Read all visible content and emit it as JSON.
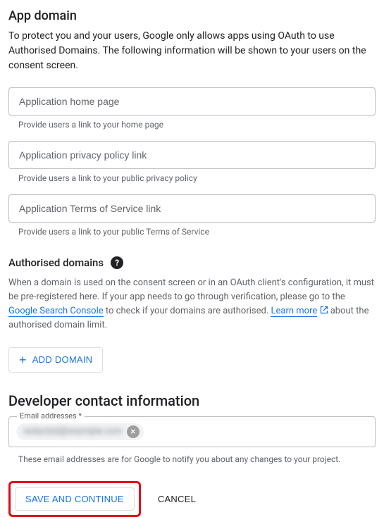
{
  "app_domain": {
    "title": "App domain",
    "description": "To protect you and your users, Google only allows apps using OAuth to use Authorised Domains. The following information will be shown to your users on the consent screen.",
    "home_page": {
      "placeholder": "Application home page",
      "helper": "Provide users a link to your home page"
    },
    "privacy": {
      "placeholder": "Application privacy policy link",
      "helper": "Provide users a link to your public privacy policy"
    },
    "tos": {
      "placeholder": "Application Terms of Service link",
      "helper": "Provide users a link to your public Terms of Service"
    }
  },
  "authorised": {
    "title": "Authorised domains",
    "para_pre": "When a domain is used on the consent screen or in an OAuth client's configuration, it must be pre-registered here. If your app needs to go through verification, please go to the ",
    "link_console": "Google Search Console",
    "para_mid": " to check if your domains are authorised. ",
    "link_learn": "Learn more",
    "para_post": " about the authorised domain limit.",
    "add_button": "ADD DOMAIN"
  },
  "developer": {
    "title": "Developer contact information",
    "email_label": "Email addresses *",
    "email_chip": "redacted@example.com",
    "email_helper": "These email addresses are for Google to notify you about any changes to your project."
  },
  "actions": {
    "save": "SAVE AND CONTINUE",
    "cancel": "CANCEL"
  }
}
